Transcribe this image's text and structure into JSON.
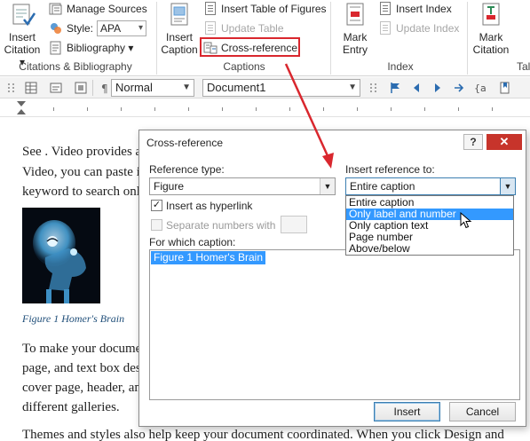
{
  "ribbon": {
    "insert_citation": [
      "Insert",
      "Citation ▾"
    ],
    "manage_sources": "Manage Sources",
    "style_label": "Style:",
    "style_value": "APA",
    "bibliography": "Bibliography ▾",
    "citations_group": "Citations & Bibliography",
    "insert_caption": [
      "Insert",
      "Caption"
    ],
    "insert_table_of_figures": "Insert Table of Figures",
    "update_table": "Update Table",
    "cross_reference": "Cross-reference",
    "captions_group": "Captions",
    "mark_entry": [
      "Mark",
      "Entry"
    ],
    "insert_index": "Insert Index",
    "update_index": "Update Index",
    "index_group": "Index",
    "mark_citation": [
      "Mark",
      "Citation"
    ],
    "toa_group_partial": "Tal",
    "highlight_color": "#d9272e"
  },
  "toolbar": {
    "style_value": "Normal",
    "document_value": "Document1"
  },
  "document": {
    "lines": [
      "See . Video provides a powerful way to help you prove your point. When you click",
      "Video, you can paste in the embed code for the video you want to add. You can also type a",
      "keyword to search online for the video that best fits your document."
    ],
    "image_caption": "Figure 1 Homer's Brain",
    "para2": [
      "To make your document look professionally produced, Word provides header, footer, cover",
      "page, and text box designs that complement each other. For example, you can add a matching",
      "cover page, header, and sidebar. Click Insert and then choose the elements you want from the",
      "different galleries."
    ],
    "para3": "Themes and styles also help keep your document coordinated. When you click Design and"
  },
  "dialog": {
    "title": "Cross-reference",
    "help": "?",
    "close": "✕",
    "reference_type_label": "Reference type:",
    "reference_type_value": "Figure",
    "insert_reference_to_label": "Insert reference to:",
    "insert_reference_to_value": "Entire caption",
    "insert_as_hyperlink_label": "Insert as hyperlink",
    "insert_as_hyperlink_checked": "✓",
    "separate_numbers_label": "Separate numbers with",
    "for_which_caption_label": "For which caption:",
    "captions": [
      "Figure 1 Homer's Brain"
    ],
    "dropdown_options": [
      "Entire caption",
      "Only label and number",
      "Only caption text",
      "Page number",
      "Above/below"
    ],
    "hovered_option": "Only label and number",
    "insert_button": "Insert",
    "cancel_button": "Cancel",
    "accent_color": "#3399ff"
  },
  "annotation_arrow": {
    "color": "#d9272e"
  }
}
